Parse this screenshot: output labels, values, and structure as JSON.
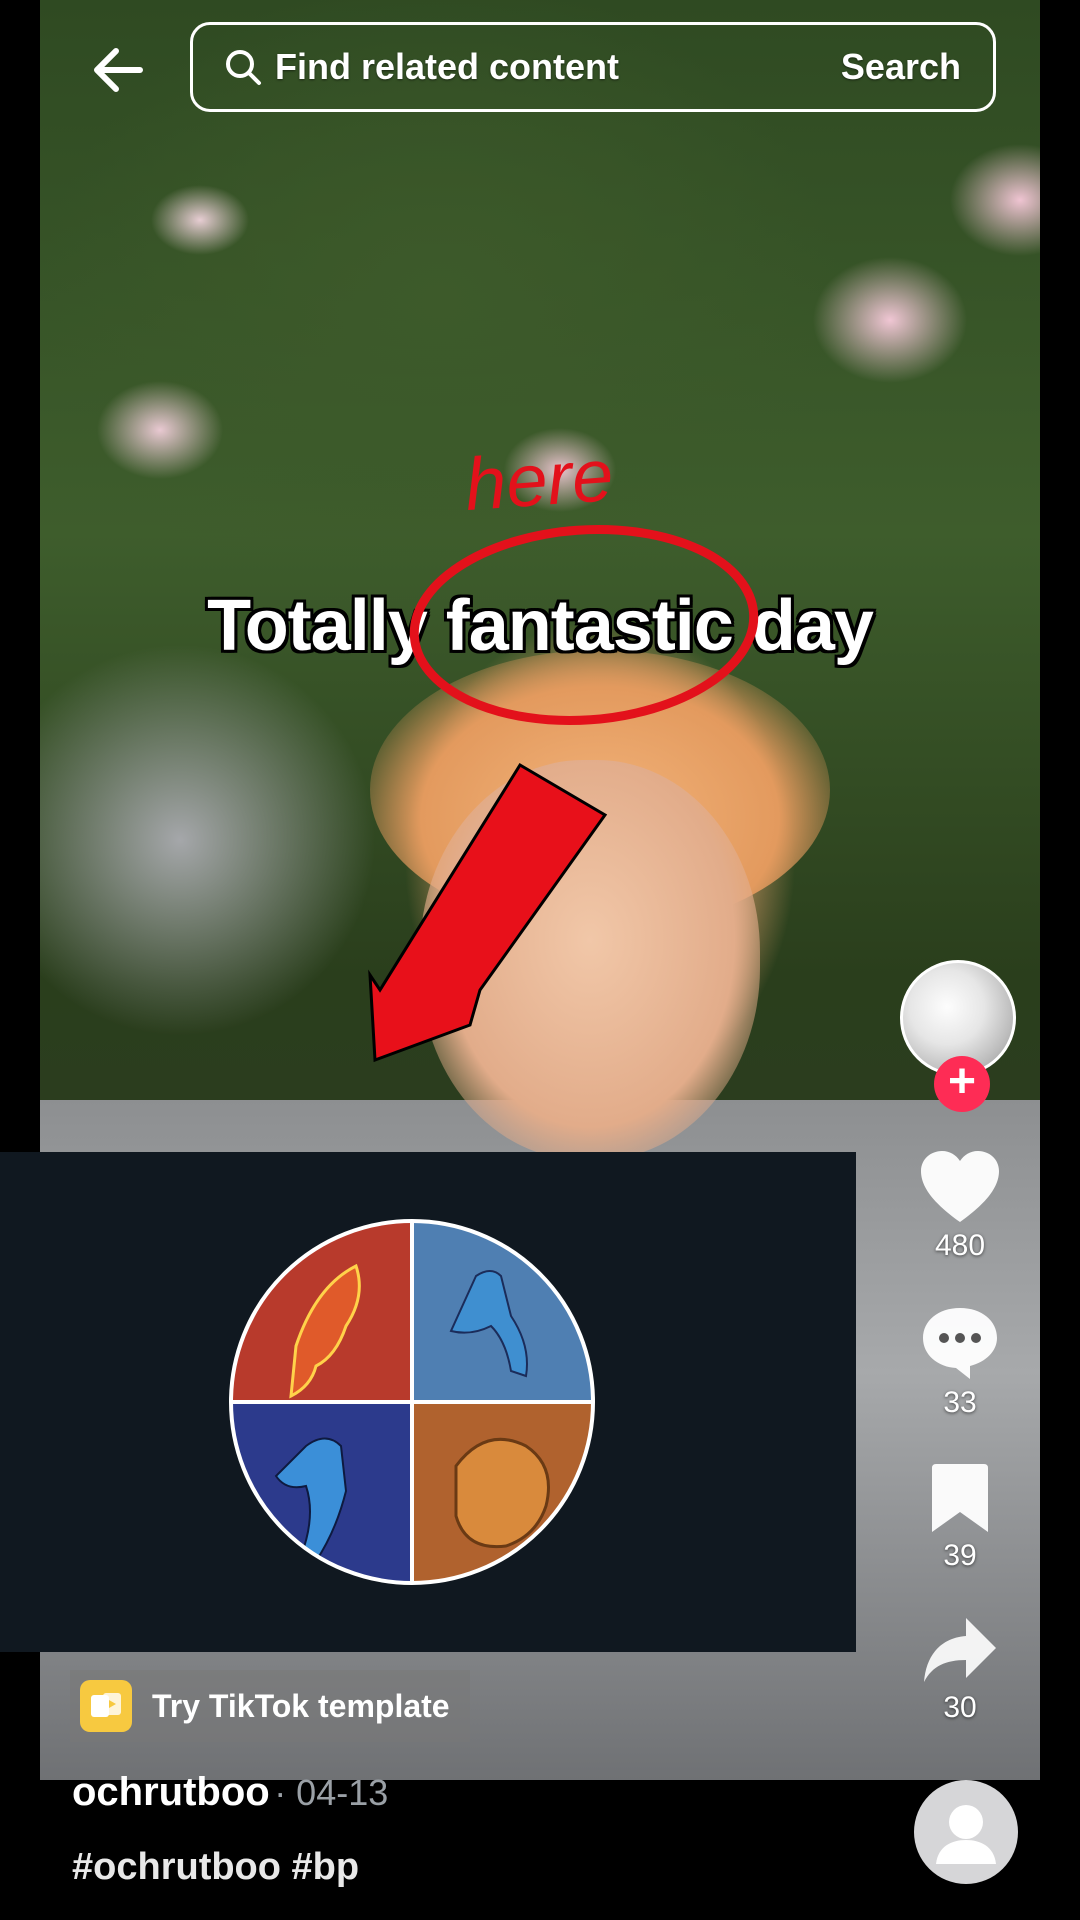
{
  "header": {
    "search_placeholder": "Find related content",
    "search_button": "Search"
  },
  "video": {
    "caption": "Totally fantastic day",
    "annotation": "here"
  },
  "actions": {
    "likes": "480",
    "comments": "33",
    "saves": "39",
    "shares": "30"
  },
  "template": {
    "label": "Try TikTok template"
  },
  "post": {
    "author": "ochrutboo",
    "date": "· 04-13",
    "hashtags": "#ochrutboo #bp"
  },
  "colors": {
    "accent": "#fe2c55",
    "annotation_red": "#e3111b",
    "panel_bg": "#101820",
    "template_yellow": "#f7c940"
  },
  "icons": [
    "back-arrow-icon",
    "search-icon",
    "heart-icon",
    "comment-icon",
    "bookmark-icon",
    "share-icon",
    "template-icon",
    "plus-icon",
    "user-icon"
  ]
}
